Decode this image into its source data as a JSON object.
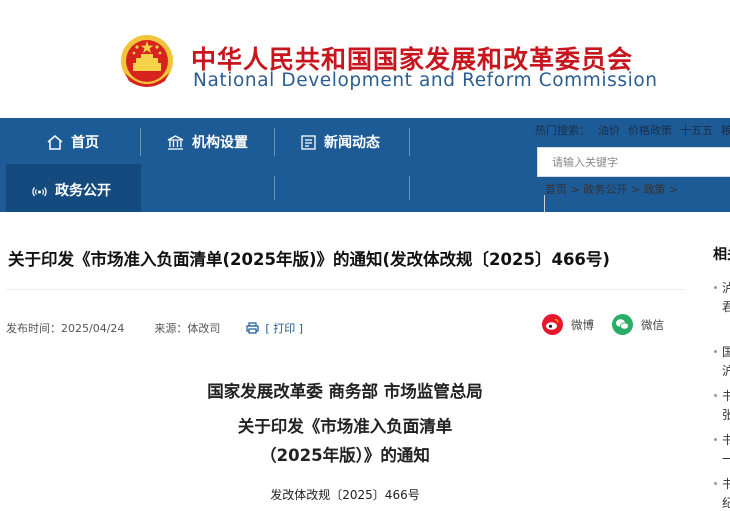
{
  "header": {
    "title_cn": "中华人民共和国国家发展和改革委员会",
    "title_en": "National Development and Reform Commission",
    "colors": {
      "title_cn": "#c8161e",
      "title_en": "#2a5d92",
      "nav_bg": "#1d5b96"
    }
  },
  "nav": {
    "items": [
      {
        "label": "首页",
        "icon": "home-icon"
      },
      {
        "label": "机构设置",
        "icon": "institution-icon"
      },
      {
        "label": "新闻动态",
        "icon": "news-icon"
      },
      {
        "label": "政务公开",
        "icon": "broadcast-icon"
      }
    ],
    "hot_words": [
      "热门搜索：",
      "油价",
      "价格政策",
      "十五五",
      "粮价"
    ],
    "search_placeholder": "请输入关键字"
  },
  "breadcrumb": {
    "items": [
      "首页",
      "政务公开",
      "政策"
    ],
    "sep": ">",
    "current": "规范性文件"
  },
  "article": {
    "title": "关于印发《市场准入负面清单(2025年版)》的通知(发改体改规〔2025〕466号)",
    "publish_label": "发布时间：",
    "publish_date": "2025/04/24",
    "source_label": "来源：",
    "source": "体改司",
    "print_label": "[ 打印 ]",
    "share_weibo": "微博",
    "share_wechat": "微信",
    "issuers": "国家发展改革委 商务部 市场监管总局",
    "heading_line1": "关于印发《市场准入负面清单",
    "heading_line2": "（2025年版）》的通知",
    "doc_number": "发改体改规〔2025〕466号"
  },
  "sidebar": {
    "title": "相关",
    "items": [
      "泸",
      "君",
      "国",
      "沪",
      "书",
      "张",
      "书",
      "一",
      "书",
      "纪"
    ]
  }
}
